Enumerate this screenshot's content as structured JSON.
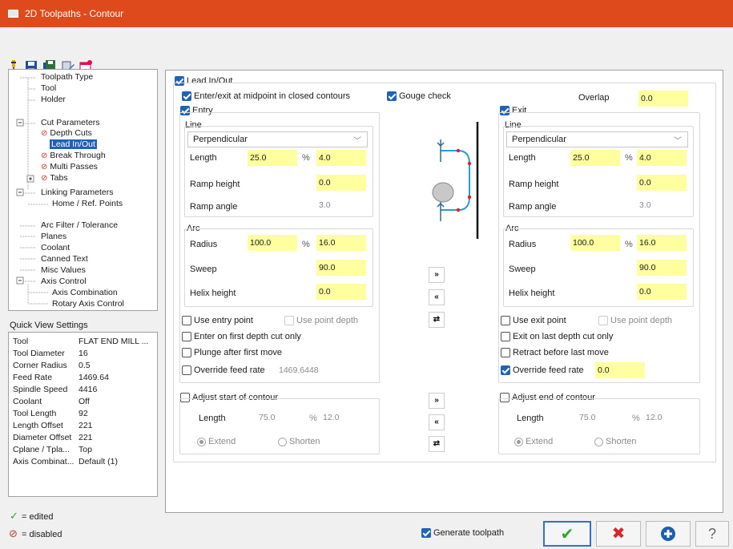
{
  "window": {
    "title": "2D Toolpaths - Contour"
  },
  "tree": {
    "items": [
      {
        "label": "Toolpath Type"
      },
      {
        "label": "Tool"
      },
      {
        "label": "Holder"
      },
      {
        "label": "Cut Parameters"
      },
      {
        "label": "Depth Cuts"
      },
      {
        "label": "Lead In/Out"
      },
      {
        "label": "Break Through"
      },
      {
        "label": "Multi Passes"
      },
      {
        "label": "Tabs"
      },
      {
        "label": "Linking Parameters"
      },
      {
        "label": "Home / Ref. Points"
      },
      {
        "label": "Arc Filter / Tolerance"
      },
      {
        "label": "Planes"
      },
      {
        "label": "Coolant"
      },
      {
        "label": "Canned Text"
      },
      {
        "label": "Misc Values"
      },
      {
        "label": "Axis Control"
      },
      {
        "label": "Axis Combination"
      },
      {
        "label": "Rotary Axis Control"
      }
    ]
  },
  "quick_view": {
    "title": "Quick View Settings",
    "rows": [
      {
        "k": "Tool",
        "v": "FLAT END MILL ..."
      },
      {
        "k": "Tool Diameter",
        "v": "16"
      },
      {
        "k": "Corner Radius",
        "v": "0.5"
      },
      {
        "k": "Feed Rate",
        "v": "1469.64"
      },
      {
        "k": "Spindle Speed",
        "v": "4416"
      },
      {
        "k": "Coolant",
        "v": "Off"
      },
      {
        "k": "Tool Length",
        "v": "92"
      },
      {
        "k": "Length Offset",
        "v": "221"
      },
      {
        "k": "Diameter Offset",
        "v": "221"
      },
      {
        "k": "Cplane / Tpla...",
        "v": "Top"
      },
      {
        "k": "Axis Combinat...",
        "v": "Default (1)"
      }
    ]
  },
  "legend": {
    "edited": "= edited",
    "disabled": "= disabled"
  },
  "main": {
    "lead_inout": "Lead In/Out",
    "midpoint": "Enter/exit at midpoint in closed contours",
    "gouge_check": "Gouge check",
    "overlap_label": "Overlap",
    "overlap_value": "0.0",
    "entry": {
      "title": "Entry",
      "line_title": "Line",
      "line_type": "Perpendicular",
      "length_label": "Length",
      "length_value": "25.0",
      "pct": "%",
      "length_abs": "4.0",
      "ramp_height_label": "Ramp height",
      "ramp_height": "0.0",
      "ramp_angle_label": "Ramp angle",
      "ramp_angle": "3.0",
      "arc_title": "Arc",
      "radius_label": "Radius",
      "radius_value": "100.0",
      "radius_abs": "16.0",
      "sweep_label": "Sweep",
      "sweep": "90.0",
      "helix_label": "Helix height",
      "helix": "0.0",
      "use_point": "Use entry point",
      "use_depth": "Use point depth",
      "first_depth": "Enter on first depth cut only",
      "plunge": "Plunge after first move",
      "override": "Override feed rate",
      "override_value": "1469.6448",
      "adjust": "Adjust start of contour",
      "adj_length_label": "Length",
      "adj_length": "75.0",
      "adj_pct": "%",
      "adj_abs": "12.0",
      "extend": "Extend",
      "shorten": "Shorten"
    },
    "exit": {
      "title": "Exit",
      "line_title": "Line",
      "line_type": "Perpendicular",
      "length_label": "Length",
      "length_value": "25.0",
      "pct": "%",
      "length_abs": "4.0",
      "ramp_height_label": "Ramp height",
      "ramp_height": "0.0",
      "ramp_angle_label": "Ramp angle",
      "ramp_angle": "3.0",
      "arc_title": "Arc",
      "radius_label": "Radius",
      "radius_value": "100.0",
      "radius_abs": "16.0",
      "sweep_label": "Sweep",
      "sweep": "90.0",
      "helix_label": "Helix height",
      "helix": "0.0",
      "use_point": "Use exit point",
      "use_depth": "Use point depth",
      "last_depth": "Exit on last depth cut only",
      "retract": "Retract before last move",
      "override": "Override feed rate",
      "override_value": "0.0",
      "adjust": "Adjust end of contour",
      "adj_length_label": "Length",
      "adj_length": "75.0",
      "adj_pct": "%",
      "adj_abs": "12.0",
      "extend": "Extend",
      "shorten": "Shorten"
    },
    "middle_buttons": {
      "copy_right": "»",
      "copy_left": "«",
      "swap": "⇄"
    },
    "generate": "Generate toolpath"
  },
  "colors": {
    "accent": "#1e63b6",
    "title_bar": "#df4a1d",
    "field": "#ffffa0",
    "ok": "#2ea62e",
    "cancel": "#d9262c"
  }
}
